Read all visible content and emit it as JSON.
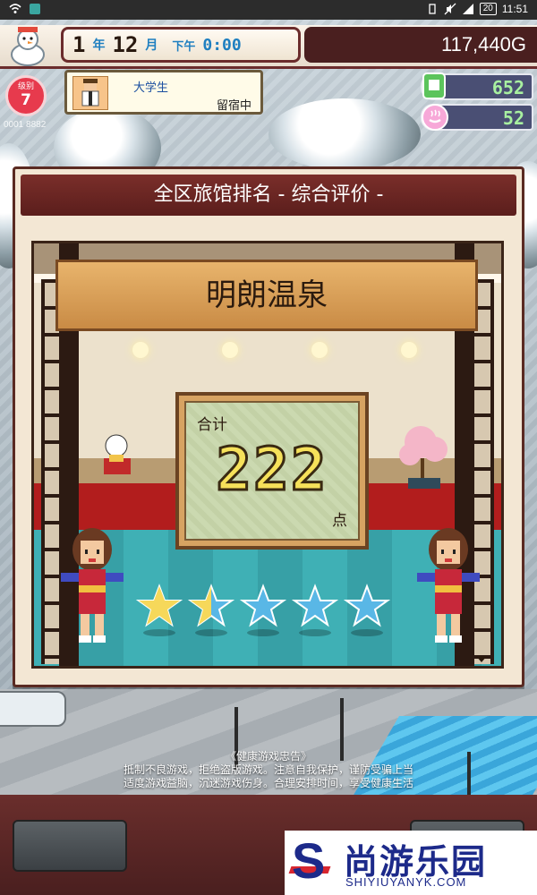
{
  "statusbar": {
    "battery": "20",
    "time": "11:51"
  },
  "hud": {
    "year_num": "1",
    "year_unit": "年",
    "month_num": "12",
    "month_unit": "月",
    "ampm": "下午",
    "clock": "0:00",
    "money": "117,440G"
  },
  "rank": {
    "label": "级别",
    "value": "7"
  },
  "guest": {
    "name": "大学生",
    "status": "留宿中"
  },
  "stats": {
    "tickets": "652",
    "onsen": "52"
  },
  "corner_text": "0001 8882",
  "dialog": {
    "title": "全区旅馆排名 - 综合评价 -",
    "inn_name": "明朗温泉",
    "score_label": "合计",
    "score": "222",
    "score_unit": "点",
    "stars_total": 5,
    "stars_filled": 1.5,
    "star_color_filled": "#f6d85a",
    "star_color_empty": "#59b7e6"
  },
  "notice": {
    "title": "《健康游戏忠告》",
    "line1": "抵制不良游戏，拒绝盗版游戏。注意自我保护，谨防受骗上当",
    "line2": "适度游戏益脑，沉迷游戏伤身。合理安排时间，享受健康生活"
  },
  "logo": {
    "mark": "S",
    "cn": "尚游乐园",
    "en": "SHIYIUYANYK.COM"
  }
}
